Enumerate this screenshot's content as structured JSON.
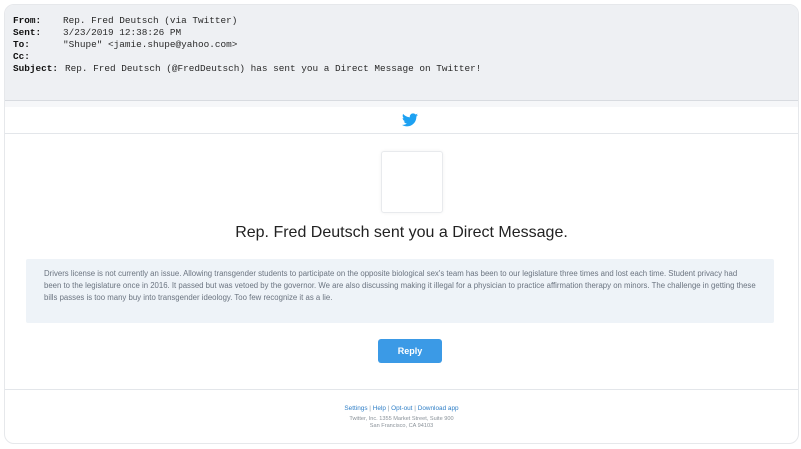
{
  "email_header": {
    "from_label": "From:",
    "from_value": "Rep. Fred Deutsch (via Twitter)",
    "sent_label": "Sent:",
    "sent_value": "3/23/2019 12:38:26 PM",
    "to_label": "To:",
    "to_value": "\"Shupe\" <jamie.shupe@yahoo.com>",
    "cc_label": "Cc:",
    "cc_value": "",
    "subject_label": "Subject:",
    "subject_value": "Rep. Fred Deutsch (@FredDeutsch) has sent you a Direct Message on Twitter!"
  },
  "logo": {
    "icon": "twitter-bird-icon",
    "color": "#1da1f2"
  },
  "body": {
    "headline": "Rep. Fred Deutsch sent you a Direct Message.",
    "message": "Drivers license is not currently an issue. Allowing transgender students to participate on the opposite biological sex's team has been to our legislature three times and lost each time. Student privacy had been to the legislature once in 2016. It passed but was vetoed by the governor. We are also discussing making it illegal for a physician to practice affirmation therapy on minors. The challenge in getting these bills passes is too many buy into transgender ideology. Too few recognize it as a lie.",
    "reply_label": "Reply",
    "accent_color": "#3b9ae6"
  },
  "footer": {
    "links": [
      "Settings",
      "Help",
      "Opt-out",
      "Download app"
    ],
    "separator": "|",
    "address_line1": "Twitter, Inc. 1355 Market Street, Suite 900",
    "address_line2": "San Francisco, CA 94103"
  }
}
